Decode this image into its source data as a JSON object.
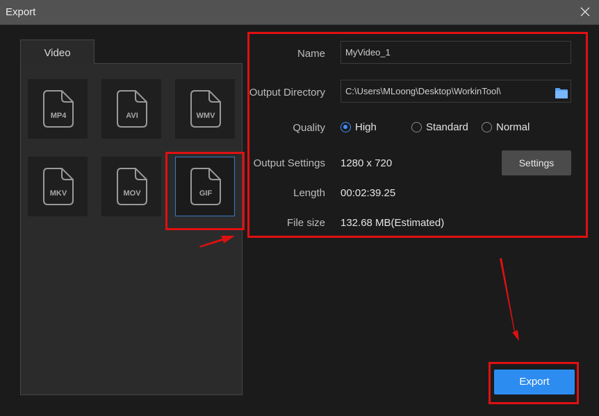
{
  "window": {
    "title": "Export",
    "close_icon": "close-x-icon"
  },
  "formats_panel": {
    "tab_label": "Video",
    "formats": [
      {
        "label": "MP4",
        "selected": false
      },
      {
        "label": "AVI",
        "selected": false
      },
      {
        "label": "WMV",
        "selected": false
      },
      {
        "label": "MKV",
        "selected": false
      },
      {
        "label": "MOV",
        "selected": false
      },
      {
        "label": "GIF",
        "selected": true
      }
    ]
  },
  "form": {
    "name_label": "Name",
    "name_value": "MyVideo_1",
    "output_dir_label": "Output Directory",
    "output_dir_value": "C:\\Users\\MLoong\\Desktop\\WorkinTool\\",
    "folder_icon": "folder-icon",
    "quality_label": "Quality",
    "quality_options": [
      {
        "label": "High",
        "checked": true
      },
      {
        "label": "Standard",
        "checked": false
      },
      {
        "label": "Normal",
        "checked": false
      }
    ],
    "output_settings_label": "Output Settings",
    "output_settings_value": "1280 x 720",
    "settings_button": "Settings",
    "length_label": "Length",
    "length_value": "00:02:39.25",
    "file_size_label": "File size",
    "file_size_value": "132.68 MB(Estimated)"
  },
  "footer": {
    "export_button": "Export"
  },
  "colors": {
    "accent": "#2d8cf0",
    "annotation": "#e01010",
    "selected_border": "#3a7bc8"
  }
}
